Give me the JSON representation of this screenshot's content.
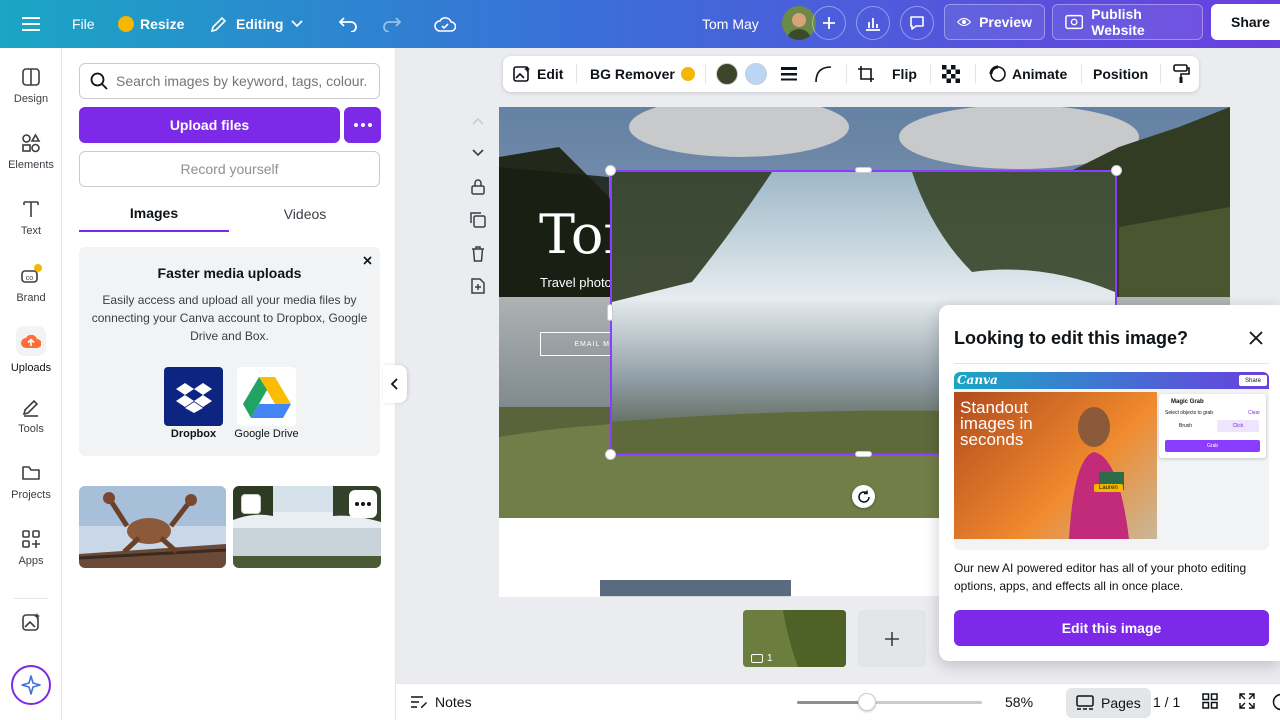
{
  "topbar": {
    "file": "File",
    "resize": "Resize",
    "editing": "Editing",
    "user_name": "Tom May",
    "preview": "Preview",
    "publish": "Publish Website",
    "share": "Share"
  },
  "rail": {
    "items": [
      {
        "label": "Design",
        "icon": "layout-icon"
      },
      {
        "label": "Elements",
        "icon": "shapes-icon"
      },
      {
        "label": "Text",
        "icon": "text-icon"
      },
      {
        "label": "Brand",
        "icon": "brand-icon"
      },
      {
        "label": "Uploads",
        "icon": "cloud-upload-icon"
      },
      {
        "label": "Tools",
        "icon": "pen-icon"
      },
      {
        "label": "Projects",
        "icon": "folder-icon"
      },
      {
        "label": "Apps",
        "icon": "apps-icon"
      }
    ]
  },
  "panel": {
    "search_placeholder": "Search images by keyword, tags, colour...",
    "upload": "Upload files",
    "record": "Record yourself",
    "tabs": [
      "Images",
      "Videos"
    ],
    "card": {
      "title": "Faster media uploads",
      "body": "Easily access and upload all your media files by connecting your Canva account to Dropbox, Google Drive and Box.",
      "dropbox": "Dropbox",
      "gdrive": "Google Drive"
    }
  },
  "context": {
    "edit": "Edit",
    "bg_remover": "BG Remover",
    "flip": "Flip",
    "animate": "Animate",
    "position": "Position",
    "color1": "#3d4427",
    "color2": "#b9d6f5"
  },
  "canvas": {
    "title": "Tom May",
    "subtitle": "Travel photography",
    "email_btn": "EMAIL ME",
    "page_thumb_num": "1"
  },
  "popup": {
    "title": "Looking to edit this image?",
    "promo_brand": "Canva",
    "promo_text": "Standout images in seconds",
    "promo_share": "Share",
    "magic_grab": "Magic Grab",
    "select_objects": "Select objects to grab",
    "clear": "Clear",
    "brush": "Brush",
    "click": "Click",
    "grab": "Grab",
    "tag": "Lauren",
    "body": "Our new AI powered editor has all of your photo editing options, apps, and effects all in once place.",
    "cta": "Edit this image"
  },
  "bottom": {
    "notes": "Notes",
    "zoom": "58%",
    "zoom_level": 0.38,
    "pages": "Pages",
    "page_count": "1 / 1"
  }
}
